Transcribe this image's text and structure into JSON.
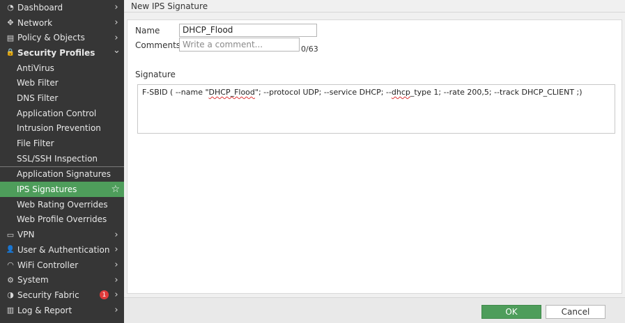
{
  "sidebar": {
    "items": [
      {
        "label": "Dashboard",
        "icon": "dashboard-icon",
        "glyph": "◔",
        "chev": "›"
      },
      {
        "label": "Network",
        "icon": "network-icon",
        "glyph": "✥",
        "chev": "›"
      },
      {
        "label": "Policy & Objects",
        "icon": "policy-icon",
        "glyph": "▤",
        "chev": "›"
      },
      {
        "label": "Security Profiles",
        "icon": "lock-icon",
        "glyph": "🔒",
        "chev": "⌄"
      }
    ],
    "sub_items": [
      "AntiVirus",
      "Web Filter",
      "DNS Filter",
      "Application Control",
      "Intrusion Prevention",
      "File Filter",
      "SSL/SSH Inspection"
    ],
    "sub_items2": [
      "Application Signatures",
      "IPS Signatures",
      "Web Rating Overrides",
      "Web Profile Overrides"
    ],
    "items_after": [
      {
        "label": "VPN",
        "icon": "laptop-icon",
        "glyph": "▭",
        "chev": "›"
      },
      {
        "label": "User & Authentication",
        "icon": "user-icon",
        "glyph": "👤",
        "chev": "›"
      },
      {
        "label": "WiFi Controller",
        "icon": "wifi-icon",
        "glyph": "◠",
        "chev": "›"
      },
      {
        "label": "System",
        "icon": "gear-icon",
        "glyph": "⚙",
        "chev": "›"
      },
      {
        "label": "Security Fabric",
        "icon": "fabric-icon",
        "glyph": "◑",
        "chev": "›",
        "badge": "1"
      },
      {
        "label": "Log & Report",
        "icon": "chart-icon",
        "glyph": "▥",
        "chev": "›"
      }
    ],
    "active_star": "☆"
  },
  "main": {
    "title": "New IPS Signature",
    "name_label": "Name",
    "name_value": "DHCP_Flood",
    "comments_label": "Comments",
    "comments_placeholder": "Write a comment...",
    "comments_counter": "0/63",
    "signature_label": "Signature",
    "signature": {
      "p1": "F-SBID ( --name \"",
      "p2": "DHCP_Flood",
      "p3": "\"; --protocol UDP; --service DHCP; --",
      "p4": "dhcp",
      "p5": "_type 1; --rate 200,5; --track DHCP_CLIENT ;)"
    }
  },
  "footer": {
    "ok_label": "OK",
    "cancel_label": "Cancel"
  },
  "colors": {
    "sidebar_bg": "#363636",
    "active_green": "#4e9d5b",
    "badge_red": "#e03a3a"
  }
}
